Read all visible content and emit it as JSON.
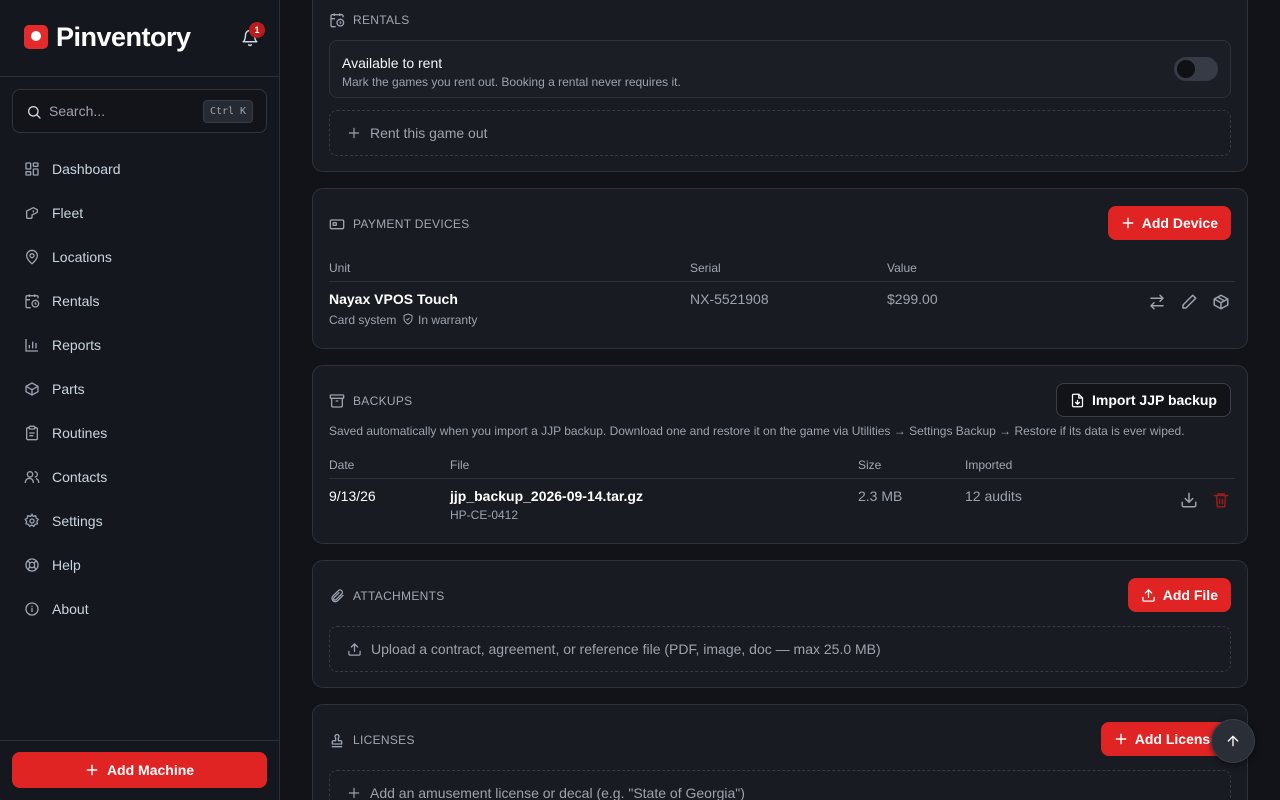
{
  "app": {
    "name": "Pinventory",
    "notifications_count": "1"
  },
  "search": {
    "placeholder": "Search...",
    "shortcut": "Ctrl K"
  },
  "nav": [
    {
      "label": "Dashboard",
      "icon": "grid-icon"
    },
    {
      "label": "Fleet",
      "icon": "pinball-icon"
    },
    {
      "label": "Locations",
      "icon": "map-pin-icon"
    },
    {
      "label": "Rentals",
      "icon": "calendar-clock-icon"
    },
    {
      "label": "Reports",
      "icon": "bar-chart-icon"
    },
    {
      "label": "Parts",
      "icon": "box-icon"
    },
    {
      "label": "Routines",
      "icon": "clipboard-icon"
    },
    {
      "label": "Contacts",
      "icon": "users-icon"
    },
    {
      "label": "Settings",
      "icon": "gear-icon"
    },
    {
      "label": "Help",
      "icon": "life-buoy-icon"
    },
    {
      "label": "About",
      "icon": "info-icon"
    }
  ],
  "add_machine_label": "Add Machine",
  "rentals": {
    "title": "RENTALS",
    "toggle_title": "Available to rent",
    "toggle_desc": "Mark the games you rent out. Booking a rental never requires it.",
    "toggle_on": false,
    "rent_out_label": "Rent this game out"
  },
  "payment_devices": {
    "title": "PAYMENT DEVICES",
    "add_label": "Add Device",
    "columns": [
      "Unit",
      "Serial",
      "Value"
    ],
    "rows": [
      {
        "unit": "Nayax VPOS Touch",
        "type": "Card system",
        "warranty": "In warranty",
        "serial": "NX-5521908",
        "value": "$299.00"
      }
    ]
  },
  "backups": {
    "title": "BACKUPS",
    "import_label": "Import JJP backup",
    "description": "Saved automatically when you import a JJP backup. Download one and restore it on the game via Utilities → Settings Backup → Restore if its data is ever wiped.",
    "columns": [
      "Date",
      "File",
      "Size",
      "Imported"
    ],
    "rows": [
      {
        "date": "9/13/26",
        "file": "jjp_backup_2026-09-14.tar.gz",
        "serial": "HP-CE-0412",
        "size": "2.3 MB",
        "imported": "12 audits"
      }
    ]
  },
  "attachments": {
    "title": "ATTACHMENTS",
    "add_label": "Add File",
    "upload_hint": "Upload a contract, agreement, or reference file (PDF, image, doc — max 25.0 MB)"
  },
  "licenses": {
    "title": "LICENSES",
    "add_label": "Add License",
    "add_hint": "Add an amusement license or decal (e.g. \"State of Georgia\")"
  },
  "colors": {
    "accent": "#e02424",
    "background": "#111318",
    "card": "#181b21"
  }
}
